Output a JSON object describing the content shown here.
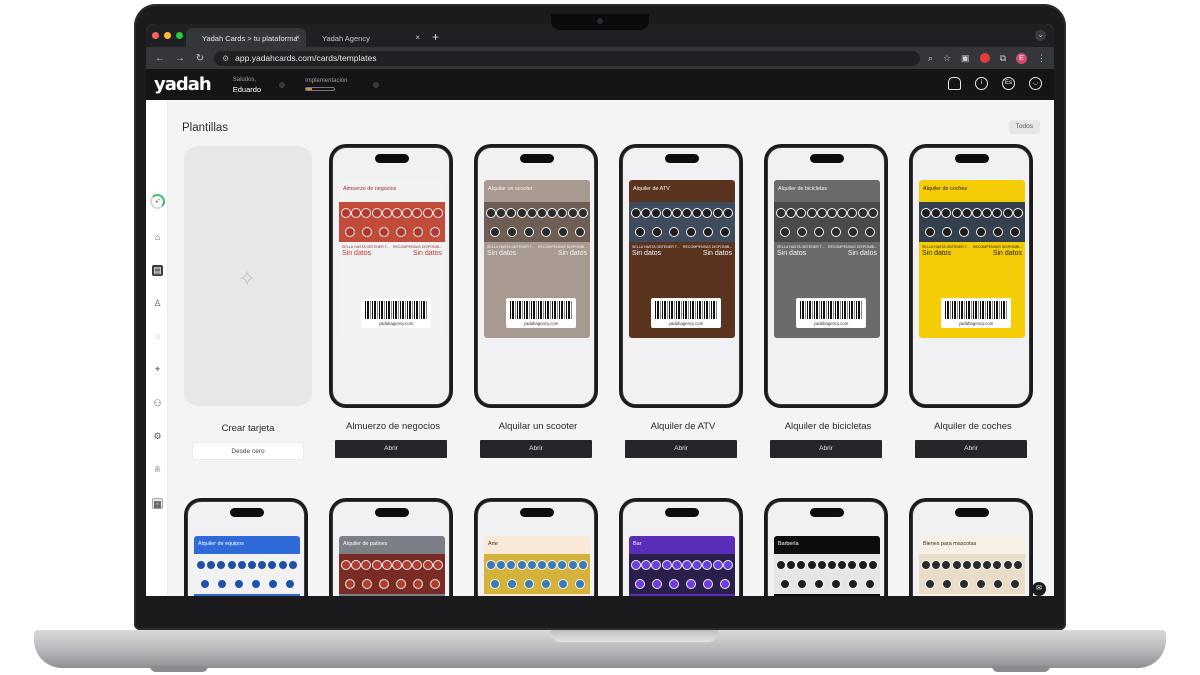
{
  "browser": {
    "tabs": [
      {
        "title": "Yadah Cards > tu plataforma",
        "close": "×"
      },
      {
        "title": "Yadah Agency",
        "close": "×"
      }
    ],
    "new_tab": "+",
    "url": "app.yadahcards.com/cards/templates"
  },
  "app": {
    "logo": "yadah",
    "greeting_label": "Saludos,",
    "user_name": "Eduardo",
    "implementation_label": "Implementación",
    "implementation_progress": 0.2,
    "lang_badge": "Es"
  },
  "page": {
    "title": "Plantillas",
    "filter": "Todos",
    "create": {
      "label": "Crear tarjeta",
      "button": "Desde cero"
    },
    "open_button": "Abrir",
    "field_left": "SELLA HASTA OBTENER T...",
    "field_right": "RECOMPENSAS DISPONIB...",
    "empty_value": "Sin datos",
    "barcode_text": "yadahagency.com"
  },
  "templates": [
    {
      "name": "Almuerzo de negocios",
      "pass_title": "Almuerzo de negocios",
      "bg": "#f2f2f3",
      "fg": "#9b2b2b",
      "strip": "#c24b3a",
      "dot": "#b3372e",
      "value": "#c0392b",
      "icon": "fork-icon"
    },
    {
      "name": "Alquilar un scooter",
      "pass_title": "Alquilar un scooter",
      "bg": "#a89a90",
      "fg": "#f4f4f4",
      "strip": "#6e5e55",
      "dot": "#2b2b2b",
      "value": "#f4f4f4",
      "icon": "scooter-icon"
    },
    {
      "name": "Alquiler de ATV",
      "pass_title": "Alquiler de ATV",
      "bg": "#5b3420",
      "fg": "#f4f4f4",
      "strip": "#3e4b5c",
      "dot": "#1d1d1d",
      "value": "#f4f4f4",
      "icon": "atv-icon"
    },
    {
      "name": "Alquiler de bicicletas",
      "pass_title": "Alquiler de bicicletas",
      "bg": "#6b6b6d",
      "fg": "#f4f4f4",
      "strip": "#4a4a4c",
      "dot": "#2b2b2b",
      "value": "#f4f4f4",
      "icon": "bicycle-icon"
    },
    {
      "name": "Alquiler de coches",
      "pass_title": "Alquiler de coches",
      "bg": "#f5cd07",
      "fg": "#1d1d1d",
      "strip": "#35404f",
      "dot": "#1d1d1d",
      "value": "#1d1d1d",
      "icon": "car-icon"
    }
  ],
  "templates_row2": [
    {
      "pass_title": "Alquiler de equipos",
      "bg": "#2e6bd8",
      "fg": "#ffffff",
      "strip": "#f2f2f2",
      "dot": "#1f4fa8"
    },
    {
      "pass_title": "Alquiler de patines",
      "bg": "#7c7f86",
      "fg": "#ffffff",
      "strip": "#7a2b24",
      "dot": "#b23a2e"
    },
    {
      "pass_title": "Arte",
      "bg": "#fbe9d7",
      "fg": "#3d2d1f",
      "strip": "#d5b23b",
      "dot": "#3a7ab8"
    },
    {
      "pass_title": "Bar",
      "bg": "#5a2db8",
      "fg": "#ffffff",
      "strip": "#2a1f4a",
      "dot": "#6a3ee0"
    },
    {
      "pass_title": "Barbería",
      "bg": "#0d0d0d",
      "fg": "#ffffff",
      "strip": "#e6e6e6",
      "dot": "#1d1d1d"
    },
    {
      "pass_title": "Bienes para mascotas",
      "bg": "#f7f0e4",
      "fg": "#3d2d1f",
      "strip": "#e9ddc7",
      "dot": "#2b2b2b"
    }
  ],
  "rail_icons": [
    "rocket-icon",
    "home-icon",
    "cards-icon",
    "users-icon",
    "chat-icon",
    "location-icon",
    "team-icon",
    "settings-icon",
    "crown-icon",
    "calculator-icon"
  ]
}
